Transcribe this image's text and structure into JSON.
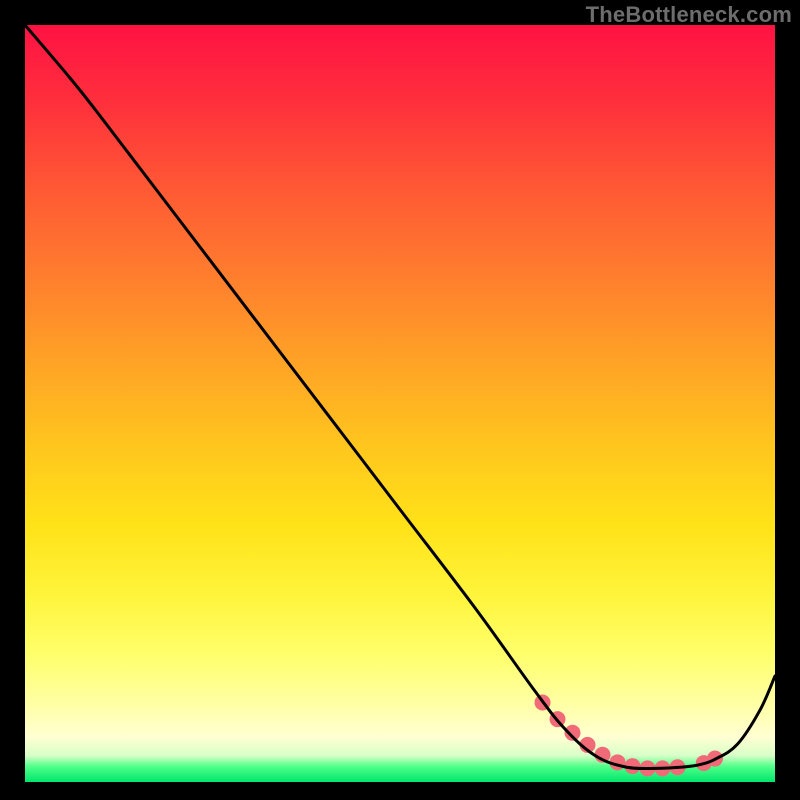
{
  "watermark": "TheBottleneck.com",
  "chart_data": {
    "type": "line",
    "title": "",
    "xlabel": "",
    "ylabel": "",
    "xlim": [
      0,
      100
    ],
    "ylim": [
      0,
      100
    ],
    "series": [
      {
        "name": "curve",
        "x": [
          0,
          6,
          10,
          20,
          30,
          40,
          50,
          60,
          68,
          72,
          76,
          80,
          84,
          88,
          90,
          92,
          95,
          98,
          100
        ],
        "y": [
          100,
          93,
          88,
          75,
          62,
          49,
          36,
          23,
          12,
          7,
          3.5,
          2,
          1.8,
          2,
          2.3,
          3,
          5,
          9.5,
          14
        ]
      }
    ],
    "markers": {
      "name": "highlight-dots",
      "x": [
        69,
        71,
        73,
        75,
        77,
        79,
        81,
        83,
        85,
        87,
        90.5,
        92
      ],
      "y": [
        10.5,
        8.3,
        6.5,
        4.9,
        3.6,
        2.6,
        2.1,
        1.8,
        1.8,
        1.95,
        2.5,
        3.1
      ],
      "color": "#f16a78",
      "radius": 8
    },
    "colors": {
      "curve": "#000000",
      "marker": "#f16a78",
      "bg_top": "#ff1243",
      "bg_bottom": "#00e66c"
    }
  }
}
